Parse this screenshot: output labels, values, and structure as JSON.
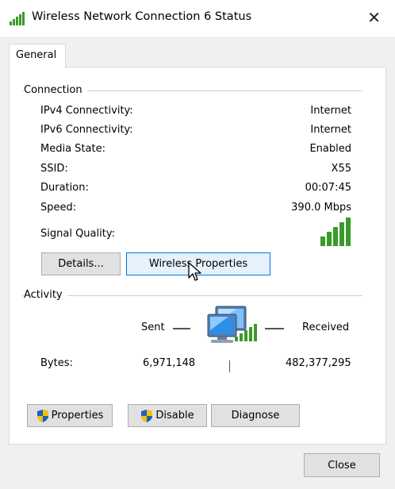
{
  "window": {
    "title": "Wireless Network Connection 6 Status"
  },
  "tabs": [
    {
      "label": "General"
    }
  ],
  "connection": {
    "group_label": "Connection",
    "rows": [
      {
        "label": "IPv4 Connectivity:",
        "value": "Internet"
      },
      {
        "label": "IPv6 Connectivity:",
        "value": "Internet"
      },
      {
        "label": "Media State:",
        "value": "Enabled"
      },
      {
        "label": "SSID:",
        "value": "X55"
      },
      {
        "label": "Duration:",
        "value": "00:07:45"
      },
      {
        "label": "Speed:",
        "value": "390.0 Mbps"
      }
    ],
    "signal_label": "Signal Quality:",
    "signal_level": 5,
    "signal_max": 5,
    "details_button": "Details...",
    "wireless_button": "Wireless Properties"
  },
  "activity": {
    "group_label": "Activity",
    "sent_label": "Sent",
    "received_label": "Received",
    "bytes_label": "Bytes:",
    "bytes_sent": "6,971,148",
    "bytes_received": "482,377,295",
    "properties_button": "Properties",
    "disable_button": "Disable",
    "diagnose_button": "Diagnose"
  },
  "footer": {
    "close_button": "Close"
  },
  "colors": {
    "signal_green": "#3a9a2a",
    "focus_border": "#0078d7",
    "shield_blue": "#1f5fbf",
    "shield_yellow": "#f2c300"
  }
}
